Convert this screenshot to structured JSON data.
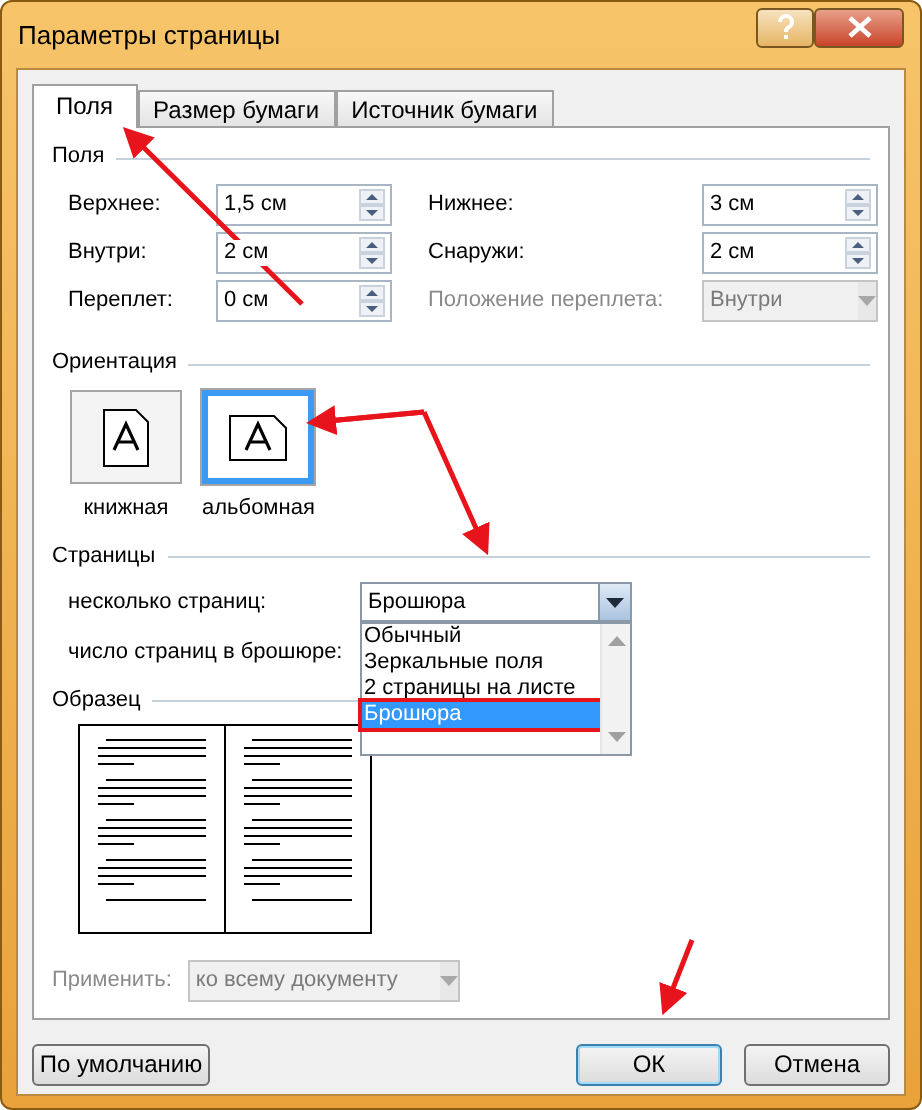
{
  "window": {
    "title": "Параметры страницы"
  },
  "tabs": [
    {
      "label": "Поля",
      "selected": true
    },
    {
      "label": "Размер бумаги",
      "selected": false
    },
    {
      "label": "Источник бумаги",
      "selected": false
    }
  ],
  "margins": {
    "heading": "Поля",
    "fields": [
      {
        "label": "Верхнее:",
        "value": "1,5 см",
        "kind": "spin",
        "disabled": false
      },
      {
        "label": "Нижнее:",
        "value": "3 см",
        "kind": "spin",
        "disabled": false
      },
      {
        "label": "Внутри:",
        "value": "2 см",
        "kind": "spin",
        "disabled": false
      },
      {
        "label": "Снаружи:",
        "value": "2 см",
        "kind": "spin",
        "disabled": false
      },
      {
        "label": "Переплет:",
        "value": "0 см",
        "kind": "spin",
        "disabled": false
      },
      {
        "label": "Положение переплета:",
        "value": "Внутри",
        "kind": "combo",
        "disabled": true
      }
    ]
  },
  "orientation": {
    "heading": "Ориентация",
    "options": [
      {
        "label": "книжная",
        "kind": "portrait",
        "selected": false
      },
      {
        "label": "альбомная",
        "kind": "landscape",
        "selected": true
      }
    ]
  },
  "pages": {
    "heading": "Страницы",
    "multiple_pages": {
      "label": "несколько страниц:",
      "value": "Брошюра",
      "expanded": true,
      "options": [
        {
          "label": "Обычный",
          "selected": false
        },
        {
          "label": "Зеркальные поля",
          "selected": false
        },
        {
          "label": "2 страницы на листе",
          "selected": false
        },
        {
          "label": "Брошюра",
          "selected": true
        }
      ]
    },
    "sheets_per_booklet": {
      "label": "число страниц в брошюре:"
    }
  },
  "preview": {
    "heading": "Образец"
  },
  "apply_to": {
    "label": "Применить:",
    "value": "ко всему документу",
    "disabled": true
  },
  "buttons": [
    {
      "label": "По умолчанию",
      "default": false
    },
    {
      "label": "ОК",
      "default": true
    },
    {
      "label": "Отмена",
      "default": false
    }
  ]
}
